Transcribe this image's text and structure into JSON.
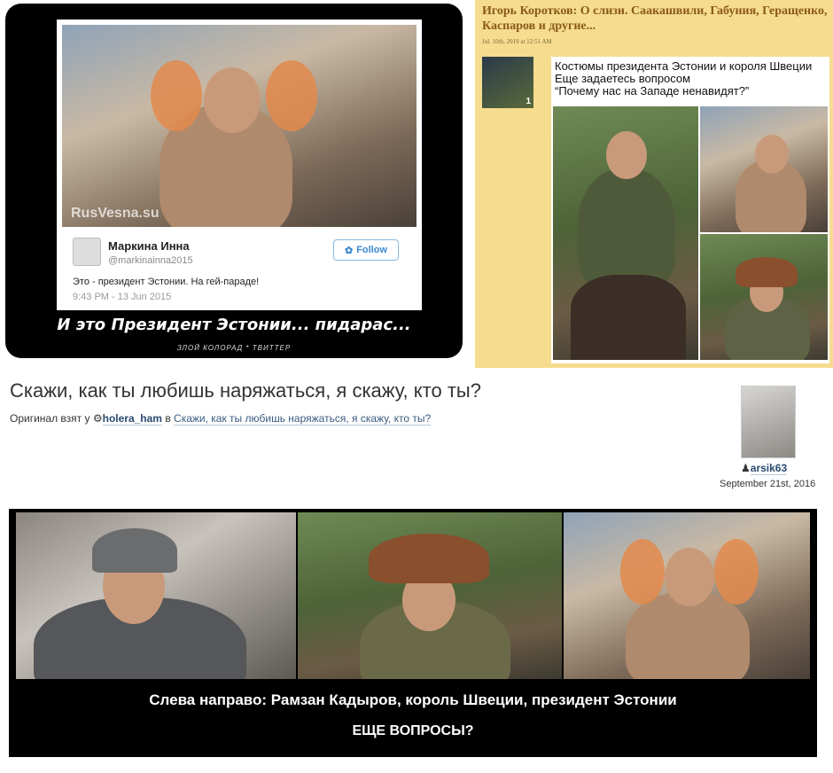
{
  "meme_left": {
    "tweet": {
      "name": "Маркина Инна",
      "handle": "@markinainna2015",
      "text": "Это - президент Эстонии. На гей-параде!",
      "time": "9:43 PM - 13 Jun 2015",
      "follow_label": "Follow"
    },
    "watermark": "RusVesna.su",
    "caption": "И это Президент Эстонии... пидарас...",
    "subcaption": "ЗЛОЙ КОЛОРАД * ТВИТТЕР"
  },
  "article": {
    "title": "Игорь Коротков: О слизи. Саакашвили, Габуния, Геращенко, Каспаров и другие...",
    "date": "Jul. 10th, 2019 at 12:51 AM",
    "thumb_label": "1",
    "text_line1": "Костюмы президента Эстонии  и короля Швеции",
    "text_line2": "Еще задаетесь вопросом",
    "text_line3": "“Почему нас на Западе ненавидят?”"
  },
  "post": {
    "title": "Скажи, как ты любишь наряжаться, я скажу, кто ты?",
    "original_prefix": "Оригинал взят у",
    "original_user": "holera_ham",
    "original_in": "в",
    "original_link": "Скажи, как ты любишь наряжаться, я скажу, кто ты?",
    "author": "arsik63",
    "date": "September 21st, 2016"
  },
  "meme_bottom": {
    "caption": "Слева направо: Рамзан Кадыров, король Швеции, президент Эстонии",
    "subcaption": "ЕЩЕ ВОПРОСЫ?"
  },
  "colors": {
    "article_bg": "#f6dc8e",
    "article_title": "#8a5a1a",
    "link": "#3c5c82",
    "twitter_blue": "#3a8ad0"
  }
}
